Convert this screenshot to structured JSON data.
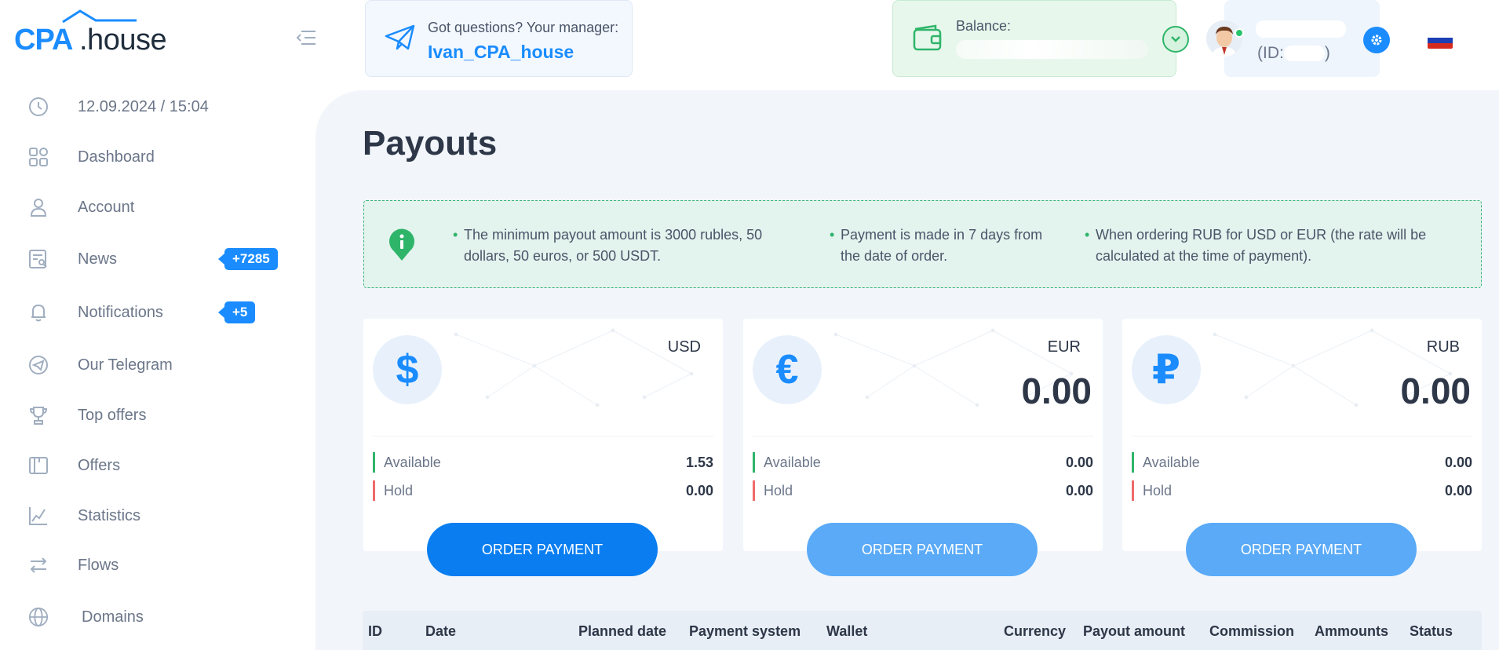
{
  "brand": {
    "logo_cpa": "CPA",
    "logo_house": ".house"
  },
  "sidebar": {
    "datetime": "12.09.2024 / 15:04",
    "items": [
      {
        "label": "Dashboard",
        "icon": "dashboard-icon"
      },
      {
        "label": "Account",
        "icon": "user-icon"
      },
      {
        "label": "News",
        "icon": "news-icon",
        "badge": "+7285"
      },
      {
        "label": "Notifications",
        "icon": "bell-icon",
        "badge": "+5"
      },
      {
        "label": "Our Telegram",
        "icon": "telegram-icon"
      },
      {
        "label": "Top offers",
        "icon": "trophy-icon"
      },
      {
        "label": "Offers",
        "icon": "offers-icon"
      },
      {
        "label": "Statistics",
        "icon": "chart-icon"
      },
      {
        "label": "Flows",
        "icon": "flows-icon"
      },
      {
        "label": "Domains",
        "icon": "globe-icon"
      }
    ]
  },
  "header": {
    "manager_question": "Got questions? Your manager:",
    "manager_name": "Ivan_CPA_house",
    "balance_label": "Balance:",
    "user_id_prefix": "(ID:",
    "user_id_suffix": ")"
  },
  "page": {
    "title": "Payouts"
  },
  "info": {
    "bullets": [
      "The minimum payout amount is 3000 rubles, 50 dollars, 50 euros, or 500 USDT.",
      "Payment is made in 7 days from the date of order.",
      "When ordering RUB for USD or EUR (the rate will be calculated at the time of payment)."
    ]
  },
  "cards": [
    {
      "symbol": "$",
      "currency": "USD",
      "amount": "",
      "available_label": "Available",
      "available": "1.53",
      "hold_label": "Hold",
      "hold": "0.00",
      "button": "ORDER PAYMENT",
      "button_state": "active"
    },
    {
      "symbol": "€",
      "currency": "EUR",
      "amount": "0.00",
      "available_label": "Available",
      "available": "0.00",
      "hold_label": "Hold",
      "hold": "0.00",
      "button": "ORDER PAYMENT",
      "button_state": "disabled"
    },
    {
      "symbol": "₽",
      "currency": "RUB",
      "amount": "0.00",
      "available_label": "Available",
      "available": "0.00",
      "hold_label": "Hold",
      "hold": "0.00",
      "button": "ORDER PAYMENT",
      "button_state": "disabled"
    }
  ],
  "table": {
    "columns": [
      "ID",
      "Date",
      "Planned date",
      "Payment system",
      "Wallet",
      "Currency",
      "Payout amount",
      "Commission",
      "Ammounts",
      "Status"
    ]
  },
  "colors": {
    "accent": "#1a8cff",
    "success": "#2fb56a",
    "danger": "#f06a6a"
  }
}
